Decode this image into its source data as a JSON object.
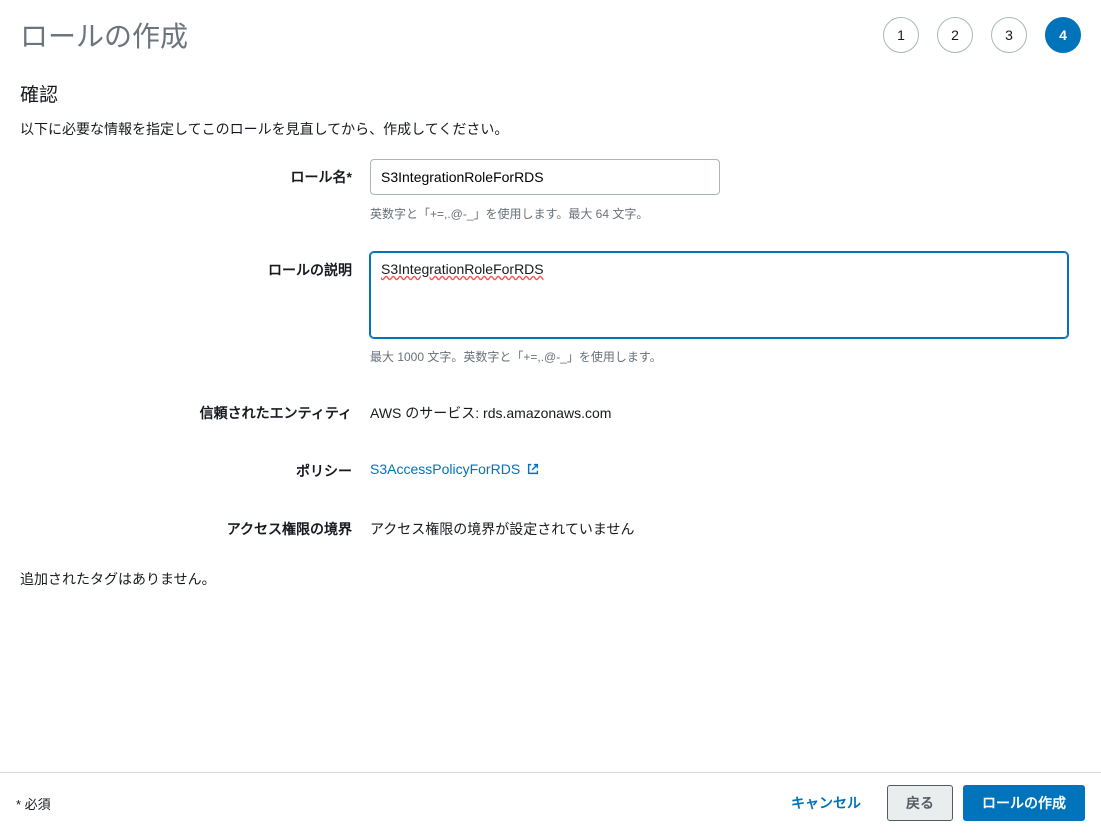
{
  "page": {
    "title": "ロールの作成",
    "section_title": "確認",
    "instruction": "以下に必要な情報を指定してこのロールを見直してから、作成してください。"
  },
  "stepper": {
    "steps": [
      "1",
      "2",
      "3",
      "4"
    ],
    "active": "4"
  },
  "form": {
    "role_name": {
      "label": "ロール名*",
      "value": "S3IntegrationRoleForRDS",
      "help": "英数字と「+=,.@-_」を使用します。最大 64 文字。"
    },
    "role_description": {
      "label": "ロールの説明",
      "value": "S3IntegrationRoleForRDS",
      "help": "最大 1000 文字。英数字と「+=,.@-_」を使用します。"
    },
    "trusted_entities": {
      "label": "信頼されたエンティティ",
      "value": "AWS のサービス: rds.amazonaws.com"
    },
    "policies": {
      "label": "ポリシー",
      "link_text": "S3AccessPolicyForRDS"
    },
    "permissions_boundary": {
      "label": "アクセス権限の境界",
      "value": "アクセス権限の境界が設定されていません"
    }
  },
  "tags": {
    "message": "追加されたタグはありません。"
  },
  "footer": {
    "required_note": "* 必須",
    "cancel": "キャンセル",
    "back": "戻る",
    "create": "ロールの作成"
  }
}
